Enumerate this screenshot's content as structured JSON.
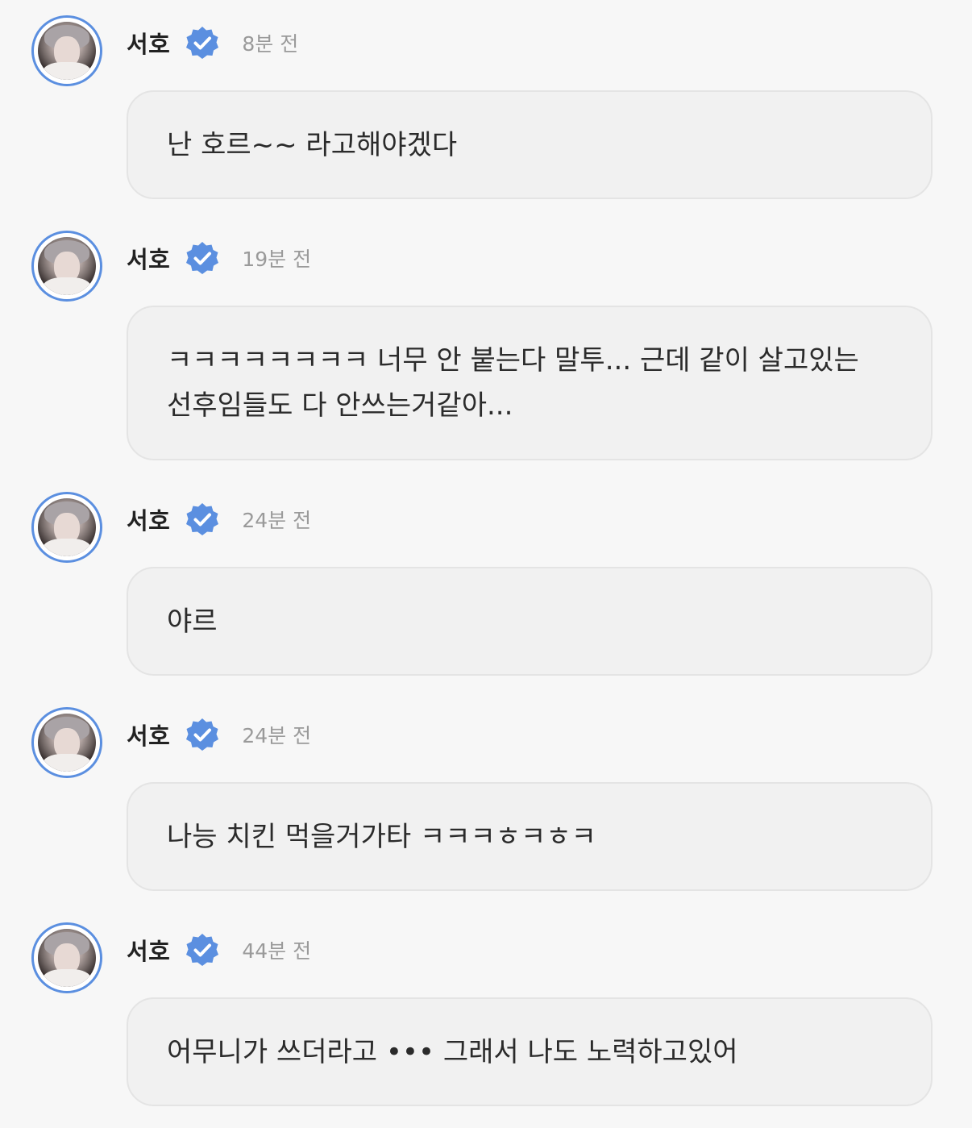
{
  "comments": [
    {
      "author": "서호",
      "time": "8분 전",
      "text": "난 호르~~ 라고해야겠다"
    },
    {
      "author": "서호",
      "time": "19분 전",
      "text": "ㅋㅋㅋㅋㅋㅋㅋㅋ 너무 안 붙는다 말투... 근데 같이 살고있는 선후임들도 다 안쓰는거같아..."
    },
    {
      "author": "서호",
      "time": "24분 전",
      "text": "야르"
    },
    {
      "author": "서호",
      "time": "24분 전",
      "text": "나능 치킨 먹을거가타 ㅋㅋㅋㅎㅋㅎㅋ"
    },
    {
      "author": "서호",
      "time": "44분 전",
      "text": "어무니가 쓰더라고 ••• 그래서 나도 노력하고있어"
    }
  ],
  "icons": {
    "verified": "verified-badge-icon",
    "avatar": "avatar-image"
  },
  "colors": {
    "accent": "#5b8fe0",
    "background": "#f7f7f7",
    "bubble": "#f1f1f1",
    "timestamp": "#9a9a9a"
  }
}
